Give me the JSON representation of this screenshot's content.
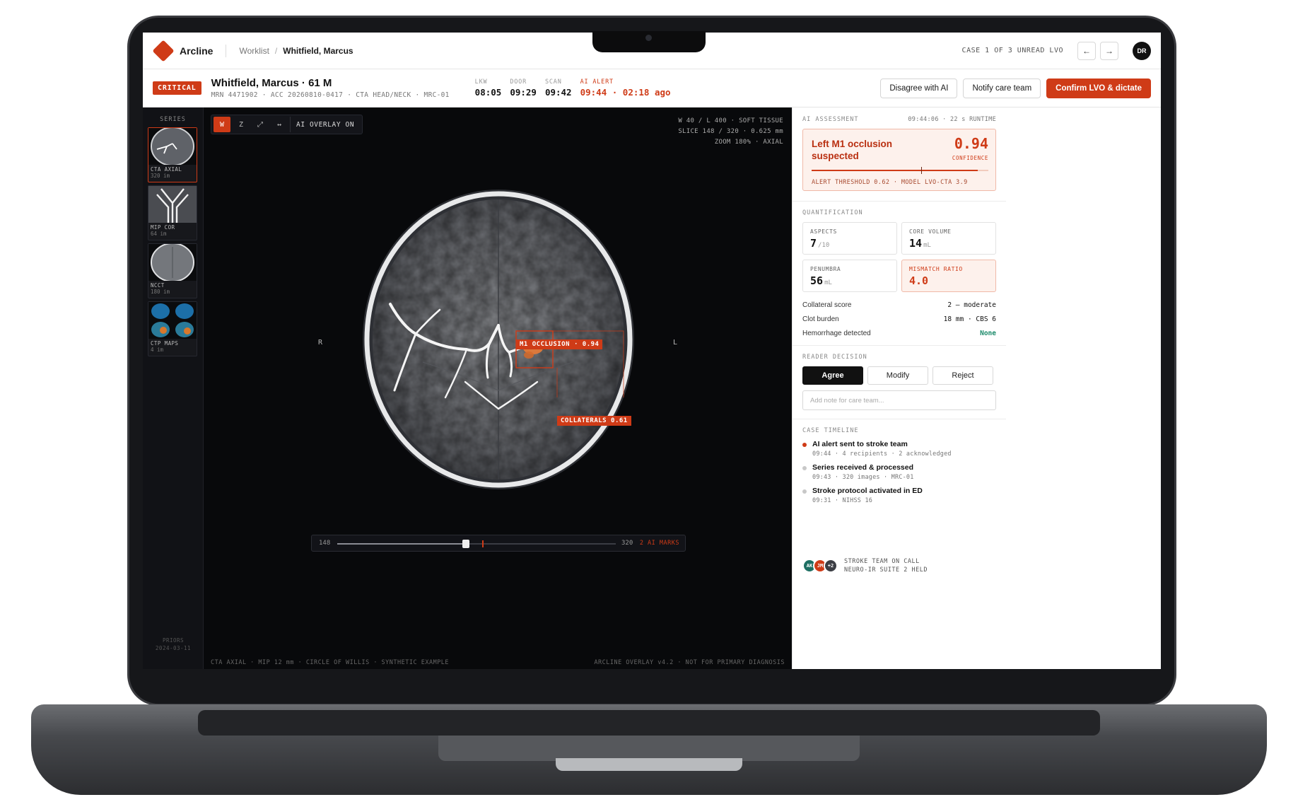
{
  "app": {
    "name": "Arcline"
  },
  "breadcrumb": {
    "root": "Worklist",
    "current": "Whitfield, Marcus"
  },
  "case_nav": {
    "counter": "CASE 1 OF 3 UNREAD LVO",
    "prev": "←",
    "next": "→",
    "user_initials": "DR"
  },
  "patient": {
    "badge": "CRITICAL",
    "name": "Whitfield, Marcus · 61 M",
    "ids": "MRN 4471902 · ACC 20260810-0417 · CTA HEAD/NECK · MRC-01"
  },
  "times": [
    {
      "label": "LKW",
      "value": "08:05",
      "alert": false
    },
    {
      "label": "DOOR",
      "value": "09:29",
      "alert": false
    },
    {
      "label": "SCAN",
      "value": "09:42",
      "alert": false
    },
    {
      "label": "AI ALERT",
      "value": "09:44 · 02:18 ago",
      "alert": true
    }
  ],
  "actions": {
    "disagree": "Disagree with AI",
    "notify": "Notify care team",
    "confirm": "Confirm LVO & dictate"
  },
  "series": {
    "title": "SERIES",
    "items": [
      {
        "name": "CTA AXIAL",
        "count": "320 im",
        "active": true,
        "icon": "axial-brain-thumbnail"
      },
      {
        "name": "MIP COR",
        "count": "64 im",
        "active": false,
        "icon": "coronal-vessels-thumbnail"
      },
      {
        "name": "NCCT",
        "count": "180 im",
        "active": false,
        "icon": "ncct-brain-thumbnail"
      },
      {
        "name": "CTP MAPS",
        "count": "4 im",
        "active": false,
        "icon": "perfusion-maps-thumbnail"
      }
    ],
    "priors_label": "PRIORS",
    "priors_date": "2024-03-11"
  },
  "viewer": {
    "tools": [
      {
        "label": "W",
        "name": "window-tool",
        "on": true
      },
      {
        "label": "Z",
        "name": "zoom-tool",
        "on": false
      },
      {
        "label": "⤢",
        "name": "expand-tool",
        "on": false
      },
      {
        "label": "↔",
        "name": "pan-tool",
        "on": false
      }
    ],
    "overlay_toggle": "AI OVERLAY ON",
    "meta": [
      "W 40 / L 400 · SOFT TISSUE",
      "SLICE 148 / 320 · 0.625 mm",
      "ZOOM 180% · AXIAL"
    ],
    "orient_left": "R",
    "orient_right": "L",
    "finding_primary": "M1 OCCLUSION · 0.94",
    "finding_secondary": "COLLATERALS 0.61",
    "slice_current": "148",
    "slice_total": "320",
    "slice_fraction": 0.4625,
    "ai_mark_fraction": 0.52,
    "ai_marks": "2 AI MARKS",
    "footer_left": "CTA AXIAL · MIP 12 mm · CIRCLE OF WILLIS · SYNTHETIC EXAMPLE",
    "footer_right": "ARCLINE OVERLAY v4.2 · NOT FOR PRIMARY DIAGNOSIS"
  },
  "ai_assessment": {
    "label": "AI ASSESSMENT",
    "runtime": "09:44:06 · 22 s RUNTIME",
    "finding": "Left M1 occlusion suspected",
    "confidence": "0.94",
    "confidence_value": 0.94,
    "threshold_value": 0.62,
    "confidence_label": "CONFIDENCE",
    "threshold_text": "ALERT THRESHOLD 0.62 · MODEL LVO-CTA 3.9"
  },
  "quantification": {
    "label": "QUANTIFICATION",
    "metrics": [
      {
        "label": "ASPECTS",
        "value": "7",
        "unit": "/10",
        "warn": false
      },
      {
        "label": "CORE VOLUME",
        "value": "14",
        "unit": "mL",
        "warn": false
      },
      {
        "label": "PENUMBRA",
        "value": "56",
        "unit": "mL",
        "warn": false
      },
      {
        "label": "MISMATCH RATIO",
        "value": "4.0",
        "unit": "",
        "warn": true
      }
    ],
    "rows": [
      {
        "key": "Collateral score",
        "value": "2 — moderate",
        "ok": false
      },
      {
        "key": "Clot burden",
        "value": "18 mm · CBS 6",
        "ok": false
      },
      {
        "key": "Hemorrhage detected",
        "value": "None",
        "ok": true
      }
    ]
  },
  "reader_decision": {
    "label": "READER DECISION",
    "agree": "Agree",
    "modify": "Modify",
    "reject": "Reject",
    "note_placeholder": "Add note for care team..."
  },
  "timeline": {
    "label": "CASE TIMELINE",
    "items": [
      {
        "title": "AI alert sent to stroke team",
        "sub": "09:44 · 4 recipients · 2 acknowledged",
        "active": true
      },
      {
        "title": "Series received & processed",
        "sub": "09:43 · 320 images · MRC-01",
        "active": false
      },
      {
        "title": "Stroke protocol activated in ED",
        "sub": "09:31 · NIHSS 16",
        "active": false
      }
    ]
  },
  "team": {
    "avatars": [
      {
        "initials": "AK",
        "color": "#1e6f63"
      },
      {
        "initials": "JM",
        "color": "#cf3b17"
      },
      {
        "initials": "+2",
        "color": "#3c3e44"
      }
    ],
    "line1": "STROKE TEAM ON CALL",
    "line2": "NEURO-IR SUITE 2 HELD"
  }
}
